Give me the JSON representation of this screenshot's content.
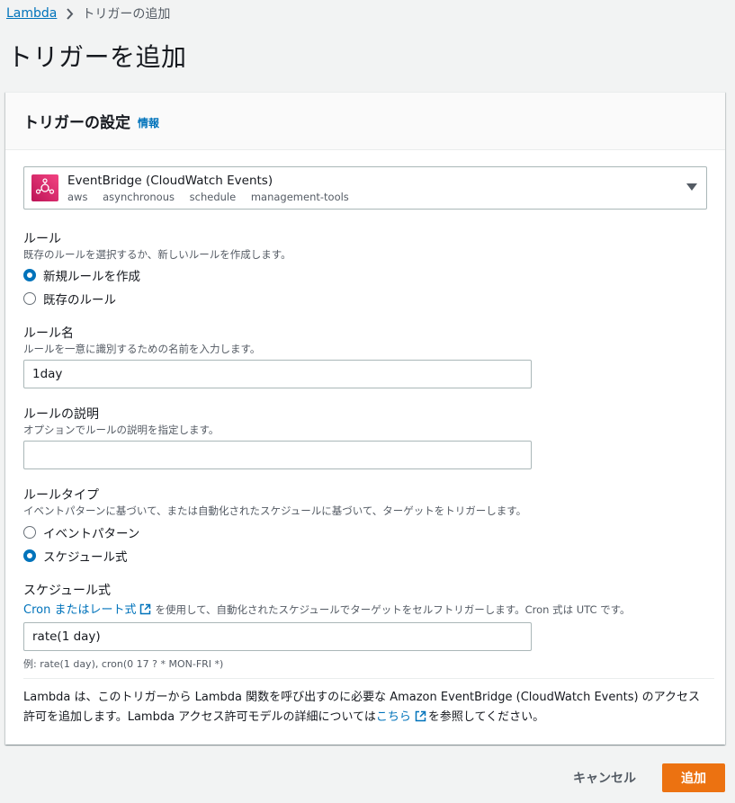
{
  "breadcrumb": {
    "root": "Lambda",
    "current": "トリガーの追加"
  },
  "page": {
    "title": "トリガーを追加"
  },
  "panel": {
    "title": "トリガーの設定",
    "info": "情報"
  },
  "trigger": {
    "name": "EventBridge (CloudWatch Events)",
    "tags": [
      "aws",
      "asynchronous",
      "schedule",
      "management-tools"
    ],
    "icon": "eventbridge-icon"
  },
  "rule": {
    "label": "ルール",
    "desc": "既存のルールを選択するか、新しいルールを作成します。",
    "options": [
      "新規ルールを作成",
      "既存のルール"
    ],
    "selected": 0
  },
  "rule_name": {
    "label": "ルール名",
    "desc": "ルールを一意に識別するための名前を入力します。",
    "value": "1day"
  },
  "rule_desc": {
    "label": "ルールの説明",
    "desc": "オプションでルールの説明を指定します。",
    "value": ""
  },
  "rule_type": {
    "label": "ルールタイプ",
    "desc": "イベントパターンに基づいて、または自動化されたスケジュールに基づいて、ターゲットをトリガーします。",
    "options": [
      "イベントパターン",
      "スケジュール式"
    ],
    "selected": 1
  },
  "schedule": {
    "label": "スケジュール式",
    "link": "Cron またはレート式",
    "desc_rest": "を使用して、自動化されたスケジュールでターゲットをセルフトリガーします。Cron 式は UTC です。",
    "value": "rate(1 day)",
    "example": "例: rate(1 day), cron(0 17 ? * MON-FRI *)"
  },
  "notice": {
    "before": "Lambda は、このトリガーから Lambda 関数を呼び出すのに必要な Amazon EventBridge (CloudWatch Events) のアクセス許可を追加します。Lambda アクセス許可モデルの詳細については",
    "link": "こちら",
    "after": "を参照してください。"
  },
  "actions": {
    "cancel": "キャンセル",
    "add": "追加"
  },
  "colors": {
    "accent": "#0073bb",
    "primary_button": "#ec7211",
    "background": "#f2f3f3"
  }
}
